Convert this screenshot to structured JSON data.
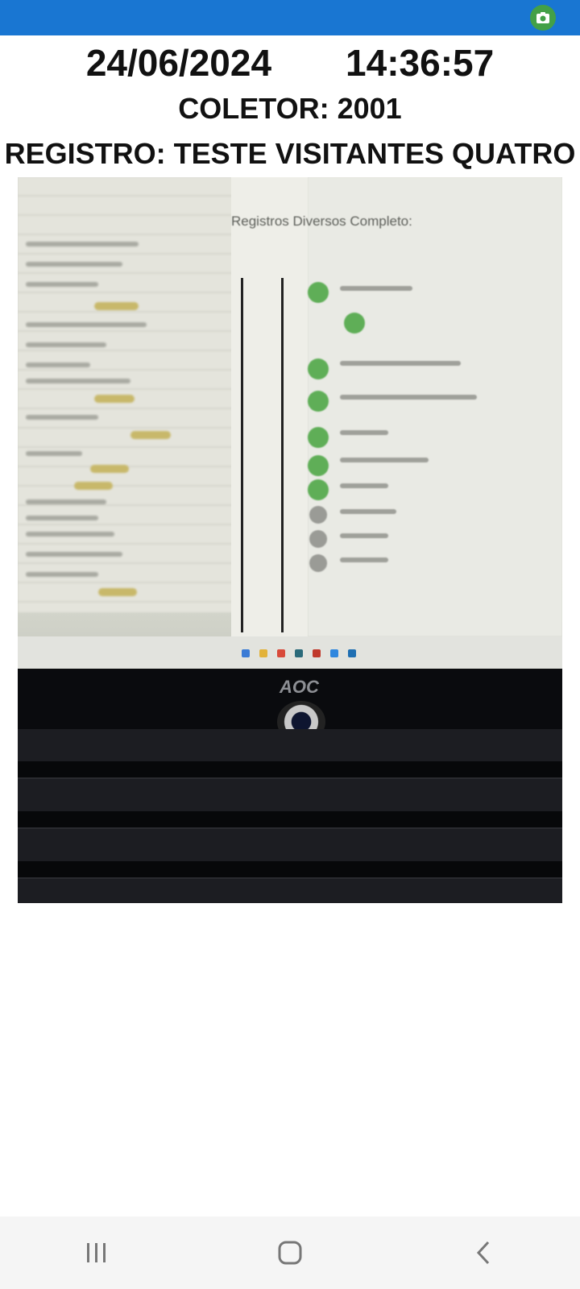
{
  "status_bar": {
    "color": "#1976d2",
    "camera_icon": "camera-icon"
  },
  "header": {
    "date": "24/06/2024",
    "time": "14:36:57",
    "coletor": "COLETOR: 2001",
    "registro": "REGISTRO: TESTE VISITANTES QUATRO"
  },
  "photo": {
    "screen_heading": "Registros Diversos Completo:",
    "brand": "AOC"
  },
  "nav_bar": {
    "recent_icon": "recent-apps-icon",
    "home_icon": "home-icon",
    "back_icon": "back-icon"
  }
}
